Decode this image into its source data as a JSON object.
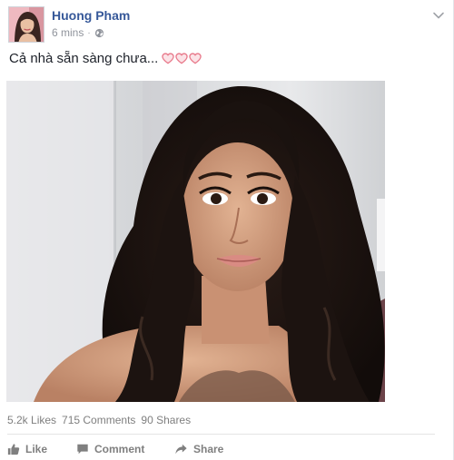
{
  "post": {
    "author": "Huong Pham",
    "time": "6 mins",
    "separator": "·",
    "audience_icon": "globe-icon",
    "text": "Cả nhà sẵn sàng chưa...",
    "text_emoji": "heart-outline-icon",
    "emoji_count": 3
  },
  "stats": {
    "likes": "5.2k Likes",
    "comments": "715 Comments",
    "shares": "90 Shares"
  },
  "actions": {
    "like": "Like",
    "comment": "Comment",
    "share": "Share"
  },
  "colors": {
    "author": "#365899",
    "meta": "#90949c",
    "stats": "#7f7f7f",
    "heart": "#e8788a"
  }
}
